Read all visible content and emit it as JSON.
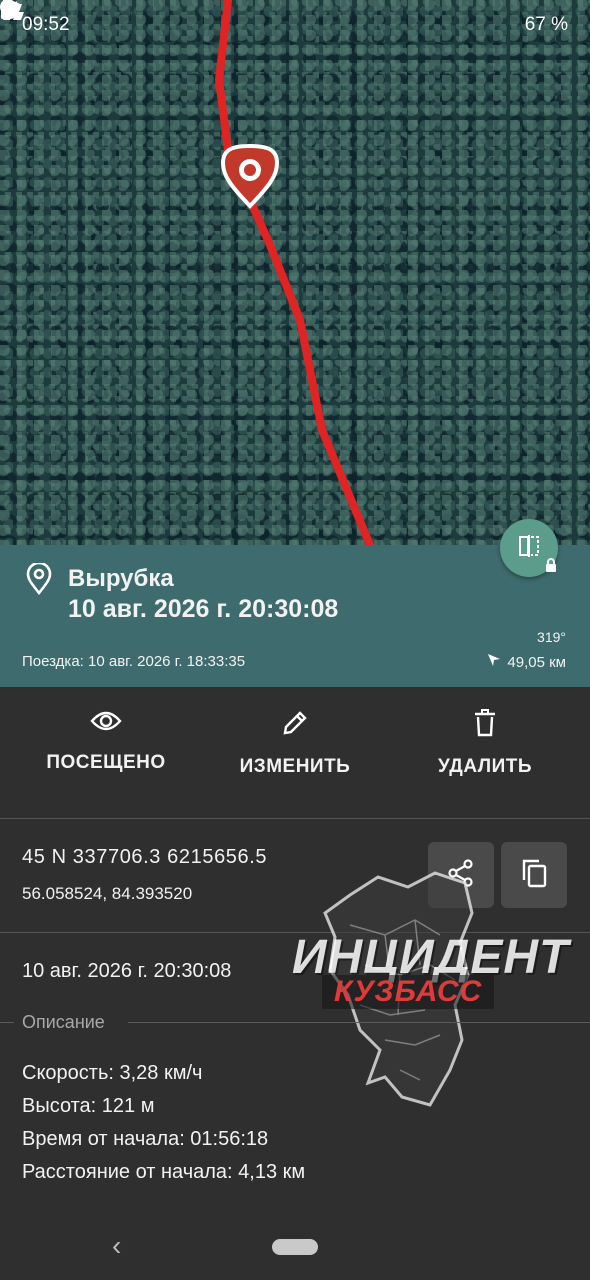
{
  "status_bar": {
    "time": "09:52",
    "battery": "67 %",
    "icons": [
      "app-logo-icon",
      "alarm-icon",
      "location-icon",
      "wifi-icon",
      "signal-icon",
      "battery-icon"
    ]
  },
  "map": {
    "background": "satellite-forest",
    "track_color": "#e02424",
    "marker_color": "#c0392b"
  },
  "waypoint": {
    "name": "Вырубка",
    "datetime": "10 авг. 2026 г. 20:30:08",
    "trip": "Поездка: 10 авг. 2026 г. 18:33:35",
    "bearing": "319°",
    "distance": "49,05 км",
    "panel_color": "#3e6b6d"
  },
  "actions": {
    "visited": "ПОСЕЩЕНО",
    "edit": "ИЗМЕНИТЬ",
    "delete": "УДАЛИТЬ"
  },
  "location": {
    "utm": "45 N 337706.3 6215656.5",
    "latlon": "56.058524, 84.393520"
  },
  "timestamp": "10 авг. 2026 г. 20:30:08",
  "description": {
    "label": "Описание",
    "speed": "Скорость: 3,28 км/ч",
    "altitude": "Высота: 121 м",
    "elapsed": "Время от начала: 01:56:18",
    "distance_from_start": "Расстояние от начала: 4,13 км"
  },
  "watermark": {
    "title": "ИНЦИДЕНТ",
    "subtitle": "КУЗБАСС"
  }
}
